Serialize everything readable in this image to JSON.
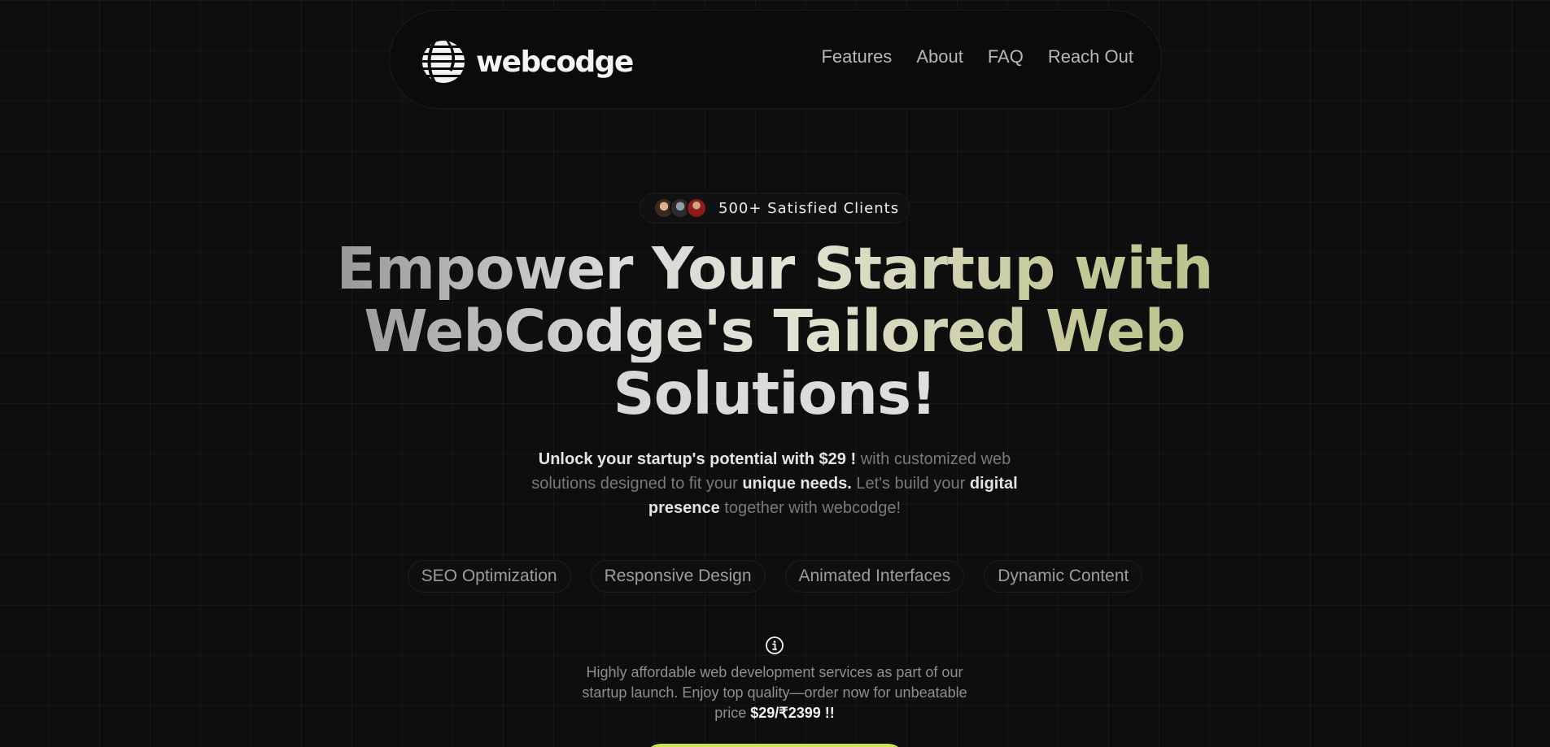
{
  "nav": {
    "brand": "webcodge",
    "links": [
      "Features",
      "About",
      "FAQ",
      "Reach Out"
    ]
  },
  "badge": {
    "text": "500+ Satisfied Clients"
  },
  "hero": {
    "line1": "Empower Your Startup with",
    "line2": "WebCodge's Tailored Web",
    "line3": "Solutions!"
  },
  "subtext": {
    "p1": "Unlock your startup's potential with $29 !",
    "p2": " with customized web solutions designed to fit your ",
    "p3": "unique needs.",
    "p4": " Let's build your ",
    "p5": "digital presence",
    "p6": " together with webcodge!"
  },
  "features": [
    "SEO Optimization",
    "Responsive Design",
    "Animated Interfaces",
    "Dynamic Content"
  ],
  "info": {
    "text": "Highly affordable web development services as part of our startup launch. Enjoy top quality—order now for unbeatable price ",
    "price": "$29/₹2399 !!"
  },
  "colors": {
    "background": "#0e0e0e",
    "accent": "#cde64e",
    "headline_tint": "#b7c28a"
  },
  "icons": {
    "logo": "striped-globe-logo",
    "info": "info-circle-icon"
  }
}
